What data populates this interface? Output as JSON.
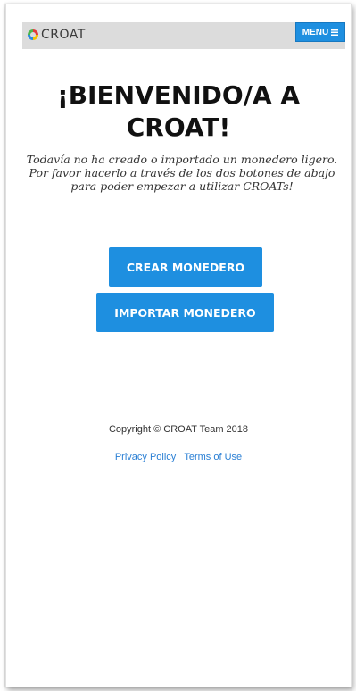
{
  "navbar": {
    "logo_text": "CROAT",
    "menu_label": "MENU"
  },
  "main": {
    "title": "¡BIENVENIDO/A A CROAT!",
    "subtitle": "Todavía no ha creado o importado un monedero ligero. Por favor hacerlo a través de los dos botones de abajo para poder empezar a utilizar CROATs!",
    "create_button": "CREAR MONEDERO",
    "import_button": "IMPORTAR MONEDERO"
  },
  "footer": {
    "copyright": "Copyright © CROAT Team 2018",
    "privacy_policy": "Privacy Policy",
    "terms_of_use": "Terms of Use"
  },
  "colors": {
    "accent": "#1e8fe0",
    "navbar_bg": "#dcdcdc",
    "link": "#2a7fd4"
  }
}
